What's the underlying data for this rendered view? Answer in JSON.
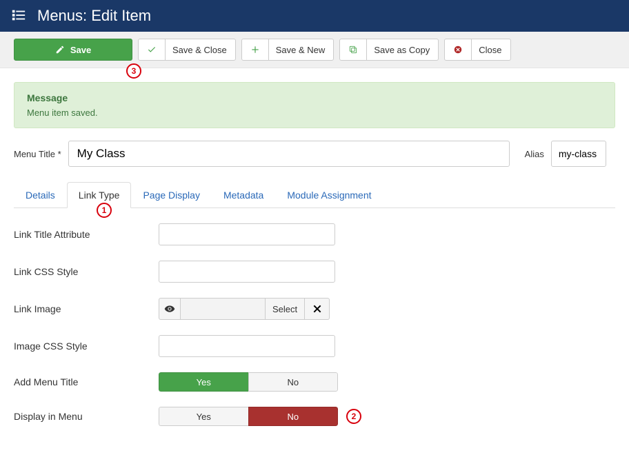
{
  "header": {
    "title": "Menus: Edit Item"
  },
  "toolbar": {
    "save": "Save",
    "save_close": "Save & Close",
    "save_new": "Save & New",
    "save_copy": "Save as Copy",
    "close": "Close"
  },
  "message": {
    "title": "Message",
    "body": "Menu item saved."
  },
  "fields": {
    "menu_title_label": "Menu Title *",
    "menu_title_value": "My Class",
    "alias_label": "Alias",
    "alias_value": "my-class"
  },
  "tabs": {
    "details": "Details",
    "link_type": "Link Type",
    "page_display": "Page Display",
    "metadata": "Metadata",
    "module_assignment": "Module Assignment"
  },
  "form": {
    "link_title_attr": "Link Title Attribute",
    "link_css_style": "Link CSS Style",
    "link_image": "Link Image",
    "link_image_select": "Select",
    "image_css_style": "Image CSS Style",
    "add_menu_title": "Add Menu Title",
    "display_in_menu": "Display in Menu",
    "yes": "Yes",
    "no": "No"
  },
  "annotations": {
    "a1": "1",
    "a2": "2",
    "a3": "3"
  }
}
